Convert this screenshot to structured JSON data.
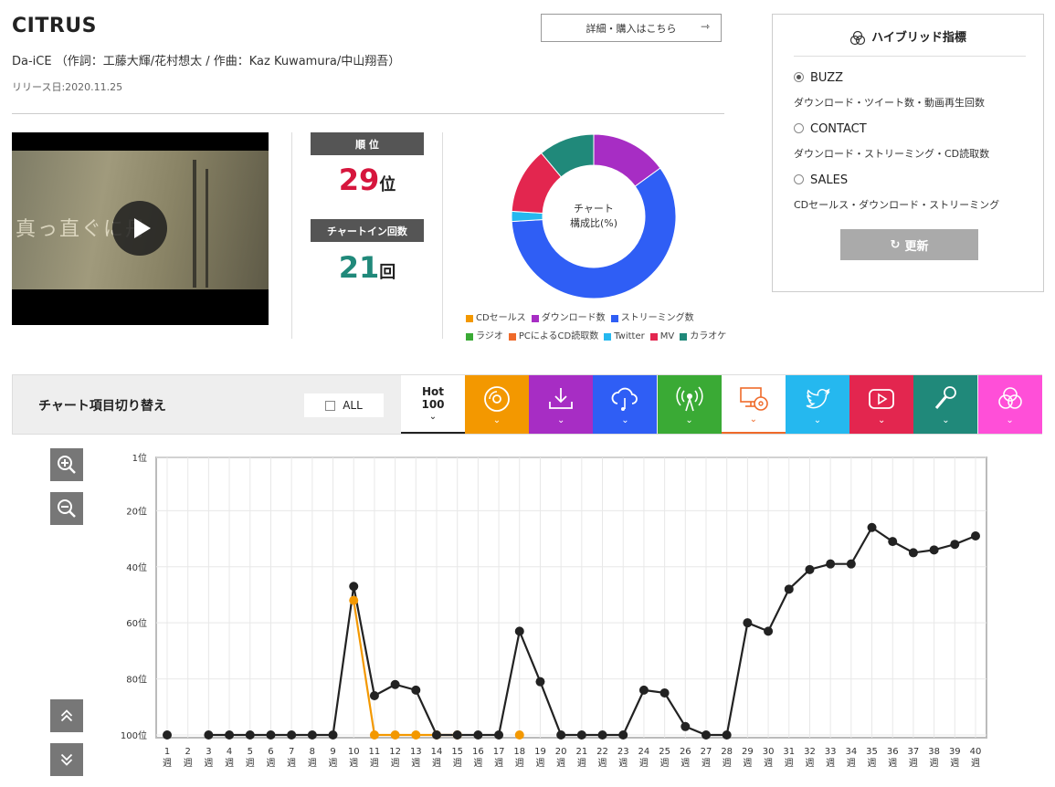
{
  "song": {
    "title": "CITRUS",
    "credits": "Da-iCE （作詞：工藤大輝/花村想太 / 作曲：Kaz Kuwamura/中山翔吾）",
    "release": "リリース日:2020.11.25",
    "detail_button": "詳細・購入はこちら",
    "video_caption": "真っ直ぐに丹"
  },
  "rank": {
    "label": "順 位",
    "value": "29",
    "unit": "位"
  },
  "chart_in": {
    "label": "チャートイン回数",
    "value": "21",
    "unit": "回"
  },
  "donut": {
    "center_line1": "チャート",
    "center_line2": "構成比(%)"
  },
  "legend": [
    {
      "label": "CDセールス",
      "color": "#f39800"
    },
    {
      "label": "ダウンロード数",
      "color": "#a72dc4"
    },
    {
      "label": "ストリーミング数",
      "color": "#2f5ef5"
    },
    {
      "label": "ラジオ",
      "color": "#3aaa35"
    },
    {
      "label": "PCによるCD読取数",
      "color": "#ef6a2a"
    },
    {
      "label": "Twitter",
      "color": "#25b8ef"
    },
    {
      "label": "MV",
      "color": "#e3264f"
    },
    {
      "label": "カラオケ",
      "color": "#20897a"
    }
  ],
  "hybrid": {
    "title": "ハイブリッド指標",
    "options": [
      {
        "label": "BUZZ",
        "desc": "ダウンロード・ツイート数・動画再生回数",
        "selected": true
      },
      {
        "label": "CONTACT",
        "desc": "ダウンロード・ストリーミング・CD読取数",
        "selected": false
      },
      {
        "label": "SALES",
        "desc": "CDセールス・ダウンロード・ストリーミング",
        "selected": false
      }
    ],
    "update_button": "更新"
  },
  "switcher": {
    "label": "チャート項目切り替え",
    "all_label": "ALL",
    "hot_label_1": "Hot",
    "hot_label_2": "100",
    "tabs": [
      {
        "name": "cd-sales",
        "color": "#f39800",
        "icon": "disc-icon"
      },
      {
        "name": "download",
        "color": "#a72dc4",
        "icon": "download-icon"
      },
      {
        "name": "streaming",
        "color": "#2f5ef5",
        "icon": "cloud-music-icon"
      },
      {
        "name": "radio",
        "color": "#3aaa35",
        "icon": "radio-icon"
      },
      {
        "name": "pc-cd-read",
        "color": "#ffffff",
        "icon": "pc-disc-icon"
      },
      {
        "name": "twitter",
        "color": "#25b8ef",
        "icon": "twitter-icon"
      },
      {
        "name": "mv",
        "color": "#e3264f",
        "icon": "play-icon"
      },
      {
        "name": "karaoke",
        "color": "#20897a",
        "icon": "microphone-icon"
      },
      {
        "name": "hybrid",
        "color": "#ff4fd8",
        "icon": "hybrid-icon"
      }
    ]
  },
  "chart_data": [
    {
      "type": "pie",
      "categories": [
        "CDセールス",
        "ダウンロード数",
        "ストリーミング数",
        "ラジオ",
        "PCによるCD読取数",
        "Twitter",
        "MV",
        "カラオケ"
      ],
      "values": [
        0,
        15,
        59,
        0,
        0,
        2,
        13,
        11
      ]
    },
    {
      "type": "line",
      "x": [
        "1週",
        "2週",
        "3週",
        "4週",
        "5週",
        "6週",
        "7週",
        "8週",
        "9週",
        "10週",
        "11週",
        "12週",
        "13週",
        "14週",
        "15週",
        "16週",
        "17週",
        "18週",
        "19週",
        "20週",
        "21週",
        "22週",
        "23週",
        "24週",
        "25週",
        "26週",
        "27週",
        "28週",
        "29週",
        "30週",
        "31週",
        "32週",
        "33週",
        "34週",
        "35週",
        "36週",
        "37週",
        "38週",
        "39週",
        "40週"
      ],
      "ylim": [
        1,
        100
      ],
      "y_inverted": true,
      "y_ticks": [
        "1位",
        "20位",
        "40位",
        "60位",
        "80位",
        "100位"
      ],
      "y_tick_values": [
        1,
        20,
        40,
        60,
        80,
        100
      ],
      "series": [
        {
          "color": "#222222",
          "values": [
            100,
            null,
            100,
            100,
            100,
            100,
            100,
            100,
            100,
            47,
            86,
            82,
            84,
            100,
            100,
            100,
            100,
            63,
            81,
            100,
            100,
            100,
            100,
            84,
            85,
            97,
            100,
            100,
            60,
            63,
            48,
            41,
            39,
            39,
            26,
            31,
            35,
            34,
            32,
            29
          ]
        },
        {
          "color": "#f39800",
          "values": [
            null,
            null,
            null,
            null,
            null,
            null,
            null,
            null,
            null,
            52,
            100,
            100,
            100,
            100,
            100,
            null,
            null,
            100,
            null,
            null,
            null,
            null,
            null,
            null,
            null,
            null,
            null,
            null,
            null,
            null,
            null,
            null,
            null,
            null,
            null,
            null,
            null,
            null,
            null,
            null
          ]
        }
      ]
    }
  ]
}
